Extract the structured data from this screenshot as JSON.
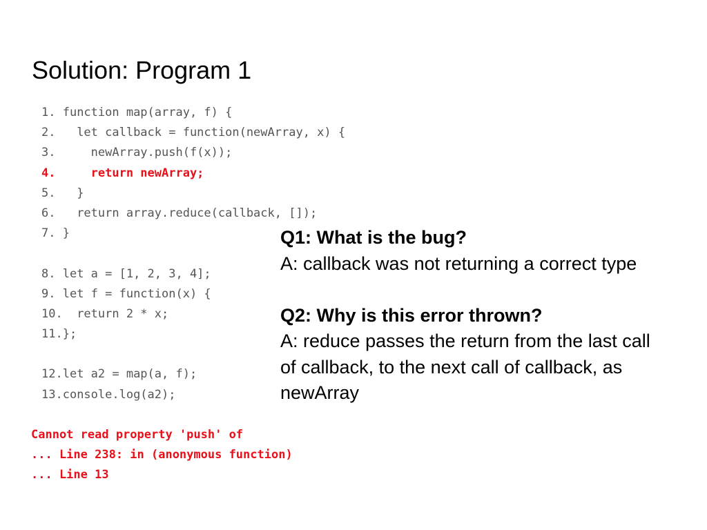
{
  "slide": {
    "title": "Solution: Program 1"
  },
  "code": {
    "lines": [
      {
        "num": "1.",
        "text": " function map(array, f) {",
        "highlight": false
      },
      {
        "num": "2.",
        "text": "   let callback = function(newArray, x) {",
        "highlight": false
      },
      {
        "num": "3.",
        "text": "     newArray.push(f(x));",
        "highlight": false
      },
      {
        "num": "4.",
        "text": "     return newArray;",
        "highlight": true
      },
      {
        "num": "5.",
        "text": "   }",
        "highlight": false
      },
      {
        "num": "6.",
        "text": "   return array.reduce(callback, []);",
        "highlight": false
      },
      {
        "num": "7.",
        "text": " }",
        "highlight": false
      },
      {
        "num": "",
        "text": "",
        "highlight": false
      },
      {
        "num": "8.",
        "text": " let a = [1, 2, 3, 4];",
        "highlight": false
      },
      {
        "num": "9.",
        "text": " let f = function(x) {",
        "highlight": false
      },
      {
        "num": "10.",
        "text": "  return 2 * x;",
        "highlight": false
      },
      {
        "num": "11.",
        "text": "};",
        "highlight": false
      },
      {
        "num": "",
        "text": "",
        "highlight": false
      },
      {
        "num": "12.",
        "text": "let a2 = map(a, f);",
        "highlight": false
      },
      {
        "num": "13.",
        "text": "console.log(a2);",
        "highlight": false
      }
    ]
  },
  "error": {
    "lines": [
      "Cannot read property 'push' of",
      "... Line 238: in (anonymous function)",
      "... Line 13"
    ]
  },
  "qa": {
    "q1": {
      "question": "Q1: What is the bug?",
      "answer": "A: callback was not returning a correct type"
    },
    "q2": {
      "question": "Q2: Why is this error thrown?",
      "answer": "A: reduce passes the return from the last call of callback, to the next call of callback, as newArray"
    }
  },
  "colors": {
    "code_text": "#555555",
    "highlight": "#e8101a",
    "title": "#000000"
  }
}
